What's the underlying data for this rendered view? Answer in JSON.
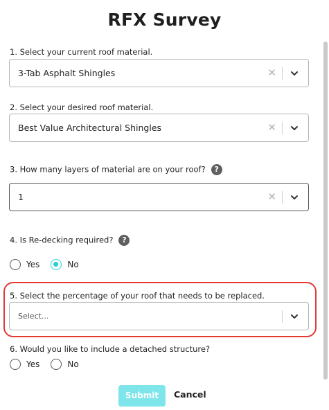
{
  "page": {
    "title": "RFX Survey"
  },
  "q1": {
    "label": "1. Select your current roof material.",
    "value": "3-Tab Asphalt Shingles",
    "clear": "✕"
  },
  "q2": {
    "label": "2. Select your desired roof material.",
    "value": "Best Value Architectural Shingles",
    "clear": "✕"
  },
  "q3": {
    "label": "3. How many layers of material are on your roof?",
    "help": "?",
    "value": "1",
    "clear": "✕"
  },
  "q4": {
    "label": "4. Is Re-decking required?",
    "help": "?",
    "options": [
      "Yes",
      "No"
    ],
    "selected": "No"
  },
  "q5": {
    "label": "5. Select the percentage of your roof that needs to be replaced.",
    "placeholder": "Select..."
  },
  "q6": {
    "label": "6. Would you like to include a detached structure?",
    "options": [
      "Yes",
      "No"
    ],
    "selected": ""
  },
  "actions": {
    "submit": "Submit",
    "cancel": "Cancel"
  },
  "colors": {
    "accent": "#22d1d8",
    "submit_bg": "#7ee5ea",
    "highlight": "#e53935"
  },
  "icons": {
    "clear": "close-icon",
    "dropdown": "chevron-down-icon",
    "help": "question-circle-icon"
  }
}
